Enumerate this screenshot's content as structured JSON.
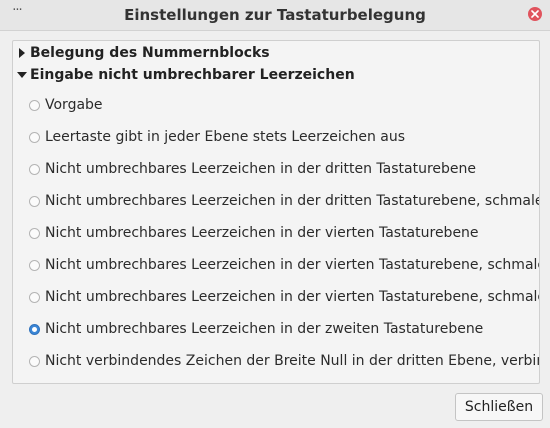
{
  "window": {
    "title": "Einstellungen zur Tastaturbelegung",
    "menu_icon": "ellipsis-icon",
    "close_icon": "close-icon",
    "close_color": "#e0535d"
  },
  "tree": {
    "collapsed": {
      "label": "Belegung des Nummernblocks",
      "icon": "triangle-right-icon"
    },
    "expanded": {
      "label": "Eingabe nicht umbrechbarer Leerzeichen",
      "icon": "triangle-down-icon",
      "options": [
        {
          "label": "Vorgabe",
          "checked": false
        },
        {
          "label": "Leertaste gibt in jeder Ebene stets Leerzeichen aus",
          "checked": false
        },
        {
          "label": "Nicht umbrechbares Leerzeichen in der dritten Tastaturebene",
          "checked": false
        },
        {
          "label": "Nicht umbrechbares Leerzeichen in der dritten Tastaturebene, schmales",
          "checked": false
        },
        {
          "label": "Nicht umbrechbares Leerzeichen in der vierten Tastaturebene",
          "checked": false
        },
        {
          "label": "Nicht umbrechbares Leerzeichen in der vierten Tastaturebene, schmales",
          "checked": false
        },
        {
          "label": "Nicht umbrechbares Leerzeichen in der vierten Tastaturebene, schmales",
          "checked": false
        },
        {
          "label": "Nicht umbrechbares Leerzeichen in der zweiten Tastaturebene",
          "checked": true
        },
        {
          "label": "Nicht verbindendes Zeichen der Breite Null in der dritten Ebene, verbind",
          "checked": false
        }
      ]
    }
  },
  "footer": {
    "close_label": "Schließen"
  },
  "colors": {
    "accent": "#3b86d6"
  }
}
